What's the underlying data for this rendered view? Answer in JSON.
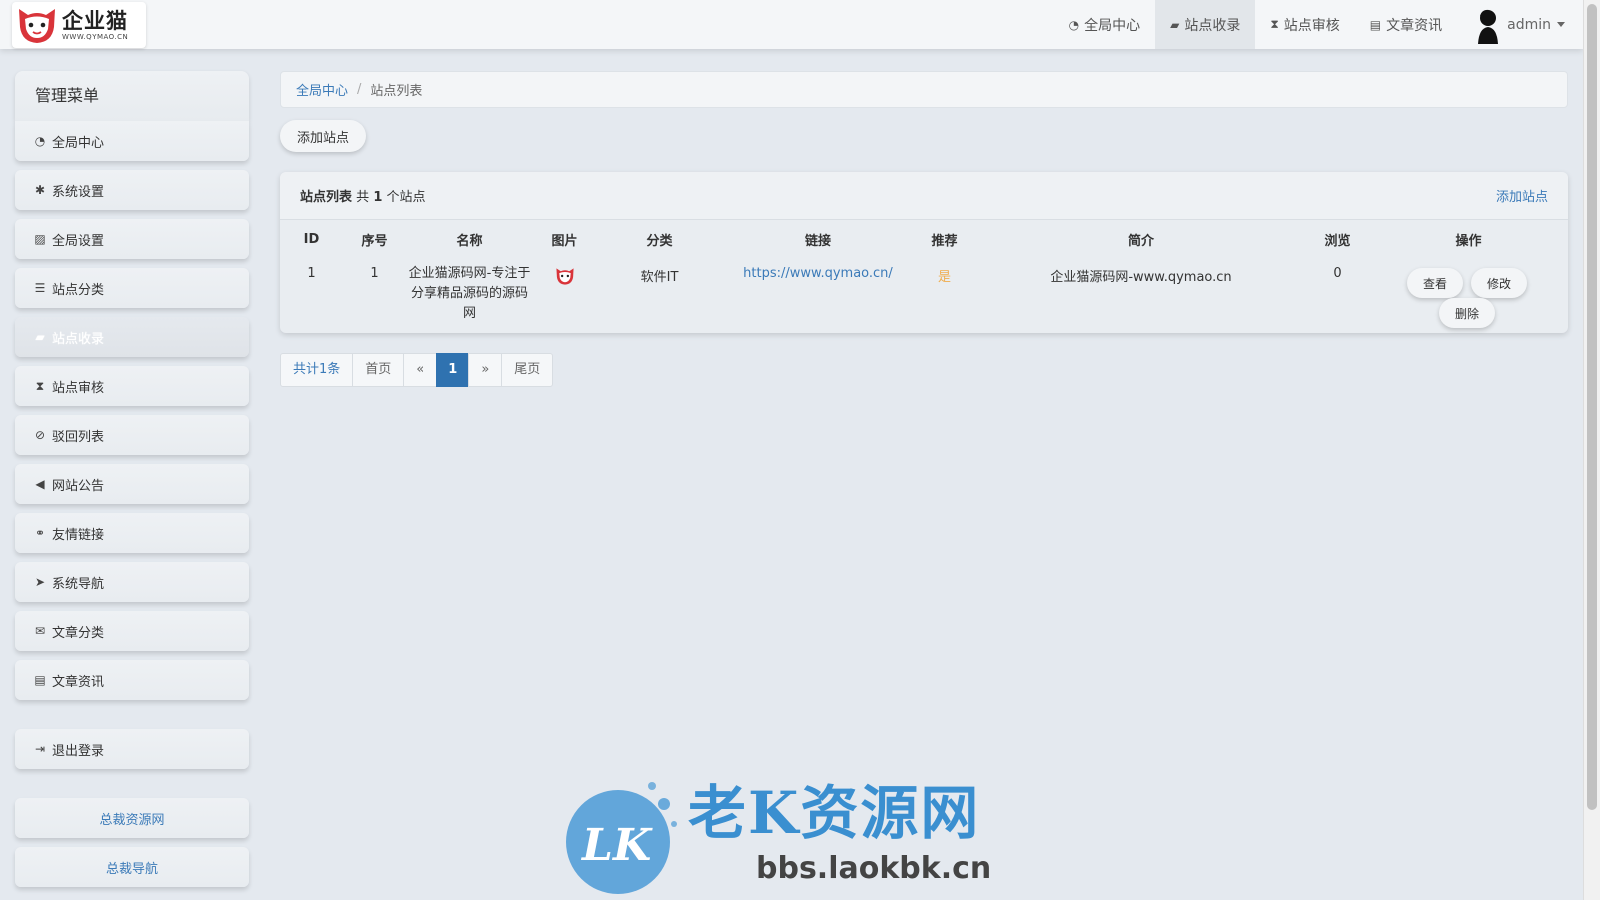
{
  "brand": {
    "name": "企业猫",
    "url": "WWW.QYMAO.CN"
  },
  "topnav": {
    "items": [
      {
        "label": "全局中心",
        "icon": "dashboard-icon",
        "active": false
      },
      {
        "label": "站点收录",
        "icon": "book-icon",
        "active": true
      },
      {
        "label": "站点审核",
        "icon": "hourglass-icon",
        "active": false
      },
      {
        "label": "文章资讯",
        "icon": "newspaper-icon",
        "active": false
      }
    ],
    "user": "admin"
  },
  "sidebar": {
    "title": "管理菜单",
    "items": [
      {
        "label": "全局中心",
        "icon": "dashboard-icon"
      },
      {
        "label": "系统设置",
        "icon": "gear-icon"
      },
      {
        "label": "全局设置",
        "icon": "image-icon"
      },
      {
        "label": "站点分类",
        "icon": "sliders-icon"
      },
      {
        "label": "站点收录",
        "icon": "book-icon",
        "active": true
      },
      {
        "label": "站点审核",
        "icon": "hourglass-icon"
      },
      {
        "label": "驳回列表",
        "icon": "ban-icon"
      },
      {
        "label": "网站公告",
        "icon": "bullhorn-icon"
      },
      {
        "label": "友情链接",
        "icon": "handshake-icon"
      },
      {
        "label": "系统导航",
        "icon": "location-arrow-icon"
      },
      {
        "label": "文章分类",
        "icon": "envelope-icon"
      },
      {
        "label": "文章资讯",
        "icon": "newspaper-icon"
      }
    ],
    "logout": "退出登录",
    "links": [
      "总裁资源网",
      "总裁导航"
    ]
  },
  "breadcrumb": {
    "home": "全局中心",
    "current": "站点列表"
  },
  "add_button": "添加站点",
  "panel": {
    "title": "站点列表",
    "count_prefix": "共",
    "count": "1",
    "count_suffix": "个站点",
    "add_link": "添加站点"
  },
  "table": {
    "headers": [
      "ID",
      "序号",
      "名称",
      "图片",
      "分类",
      "链接",
      "推荐",
      "简介",
      "浏览",
      "操作"
    ],
    "rows": [
      {
        "id": "1",
        "order": "1",
        "name": "企业猫源码网-专注于分享精品源码的源码网",
        "category": "软件IT",
        "link": "https://www.qymao.cn/",
        "recommend": "是",
        "intro": "企业猫源码网-www.qymao.cn",
        "views": "0",
        "actions": {
          "view": "查看",
          "edit": "修改",
          "delete": "删除"
        }
      }
    ]
  },
  "pager": {
    "total": "共计1条",
    "first": "首页",
    "prev": "«",
    "current": "1",
    "next": "»",
    "last": "尾页"
  },
  "watermark": {
    "title": "老K资源网",
    "url": "bbs.laokbk.cn"
  },
  "colors": {
    "link": "#3b7ab8",
    "accent": "#2f72b0",
    "recommend": "#f0ad4e",
    "brand_red": "#d9343a"
  }
}
